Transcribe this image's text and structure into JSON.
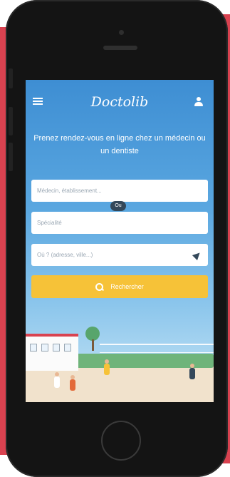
{
  "app": {
    "logo_text": "Doctolib"
  },
  "hero": {
    "headline": "Prenez rendez-vous en ligne chez un médecin ou un dentiste"
  },
  "search": {
    "name_placeholder": "Médecin, établissement...",
    "or_badge": "Ou",
    "specialty_placeholder": "Spécialité",
    "location_placeholder": "Où ? (adresse, ville...)",
    "submit_label": "Rechercher"
  },
  "colors": {
    "brand_red": "#d94250",
    "sky_blue": "#3e8ed3",
    "search_button": "#f6c238",
    "dark_navy": "#34485a"
  },
  "icons": {
    "menu": "hamburger-menu-icon",
    "user": "user-icon",
    "location": "location-arrow-icon",
    "search": "search-icon"
  }
}
